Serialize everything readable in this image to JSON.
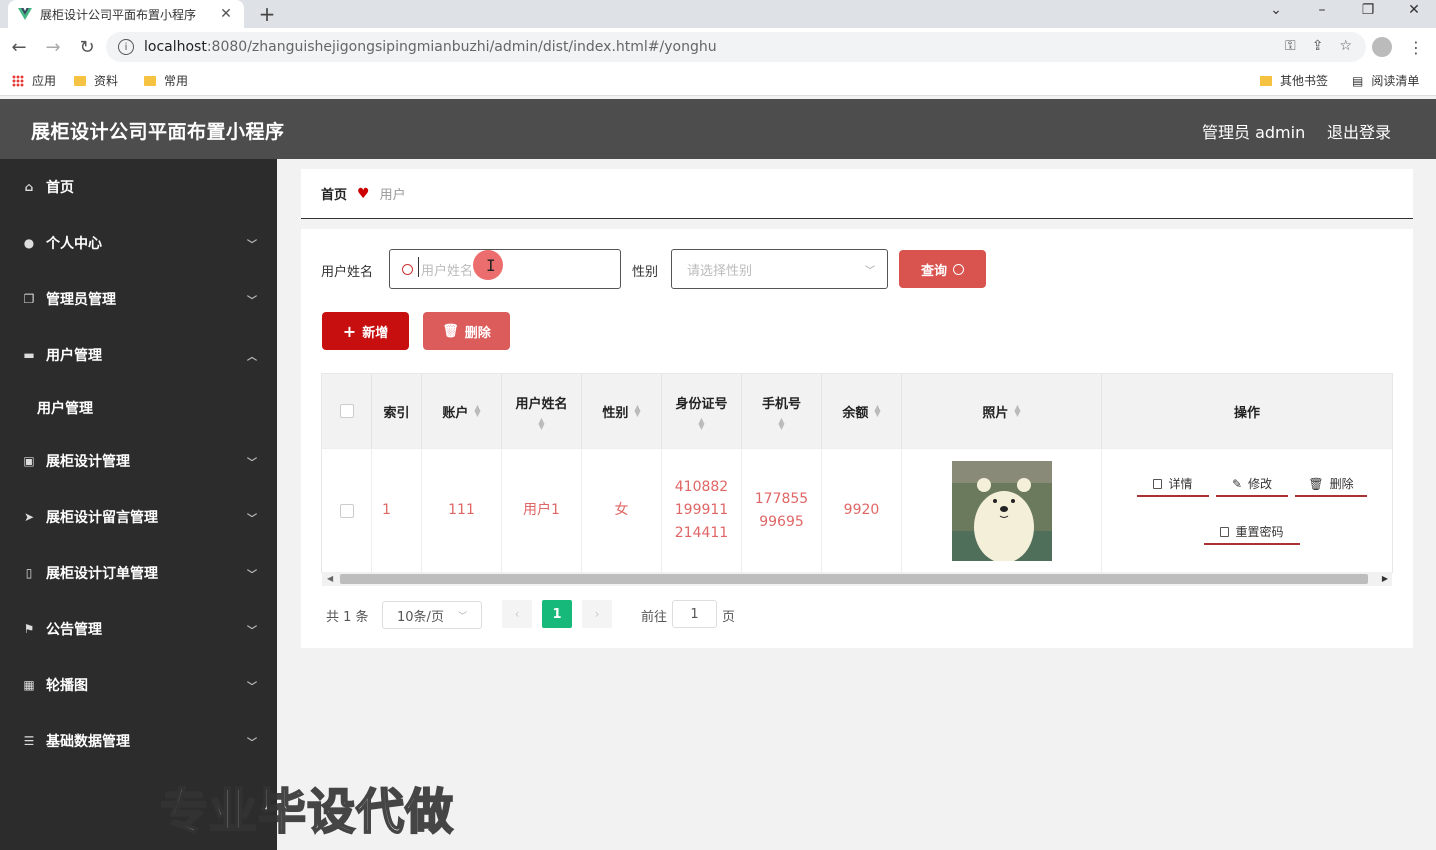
{
  "browser": {
    "tab_title": "展柜设计公司平面布置小程序",
    "url_host": "localhost",
    "url_path": ":8080/zhanguishejigongsipingmianbuzhi/admin/dist/index.html#/yonghu",
    "bookmarks": [
      "应用",
      "资料",
      "常用"
    ],
    "bookmarks_right": [
      "其他书签",
      "阅读清单"
    ]
  },
  "header": {
    "title": "展柜设计公司平面布置小程序",
    "user": "管理员 admin",
    "logout": "退出登录"
  },
  "sidebar": {
    "items": [
      {
        "label": "首页",
        "icon": "home-icon"
      },
      {
        "label": "个人中心",
        "icon": "user-icon"
      },
      {
        "label": "管理员管理",
        "icon": "copy-icon"
      },
      {
        "label": "用户管理",
        "icon": "monitor-icon"
      },
      {
        "label": "展柜设计管理",
        "icon": "briefcase-icon"
      },
      {
        "label": "展柜设计留言管理",
        "icon": "send-icon"
      },
      {
        "label": "展柜设计订单管理",
        "icon": "phone-icon"
      },
      {
        "label": "公告管理",
        "icon": "flag-icon"
      },
      {
        "label": "轮播图",
        "icon": "grid-icon"
      },
      {
        "label": "基础数据管理",
        "icon": "list-icon"
      }
    ],
    "sub_item": "用户管理"
  },
  "breadcrumb": {
    "home": "首页",
    "current": "用户"
  },
  "search": {
    "name_label": "用户姓名",
    "name_placeholder": "用户姓名",
    "gender_label": "性别",
    "gender_placeholder": "请选择性别",
    "query_button": "查询"
  },
  "actions": {
    "add": "新增",
    "delete": "删除"
  },
  "table": {
    "headers": [
      "索引",
      "账户",
      "用户姓名",
      "性别",
      "身份证号",
      "手机号",
      "余额",
      "照片",
      "操作"
    ],
    "row": {
      "index": "1",
      "account": "111",
      "name": "用户1",
      "gender": "女",
      "id_number": "410882199911214411",
      "phone": "17785599695",
      "balance": "9920"
    },
    "ops": [
      "详情",
      "修改",
      "删除",
      "重置密码"
    ]
  },
  "pagination": {
    "total": "共 1 条",
    "page_size": "10条/页",
    "current_page": "1",
    "goto_label": "前往",
    "goto_value": "1",
    "page_suffix": "页"
  },
  "watermark": "专业毕设代做",
  "colors": {
    "primary": "#c80f0f",
    "query": "#d9534f",
    "pager": "#17b97a",
    "cell_text": "#e06666"
  }
}
